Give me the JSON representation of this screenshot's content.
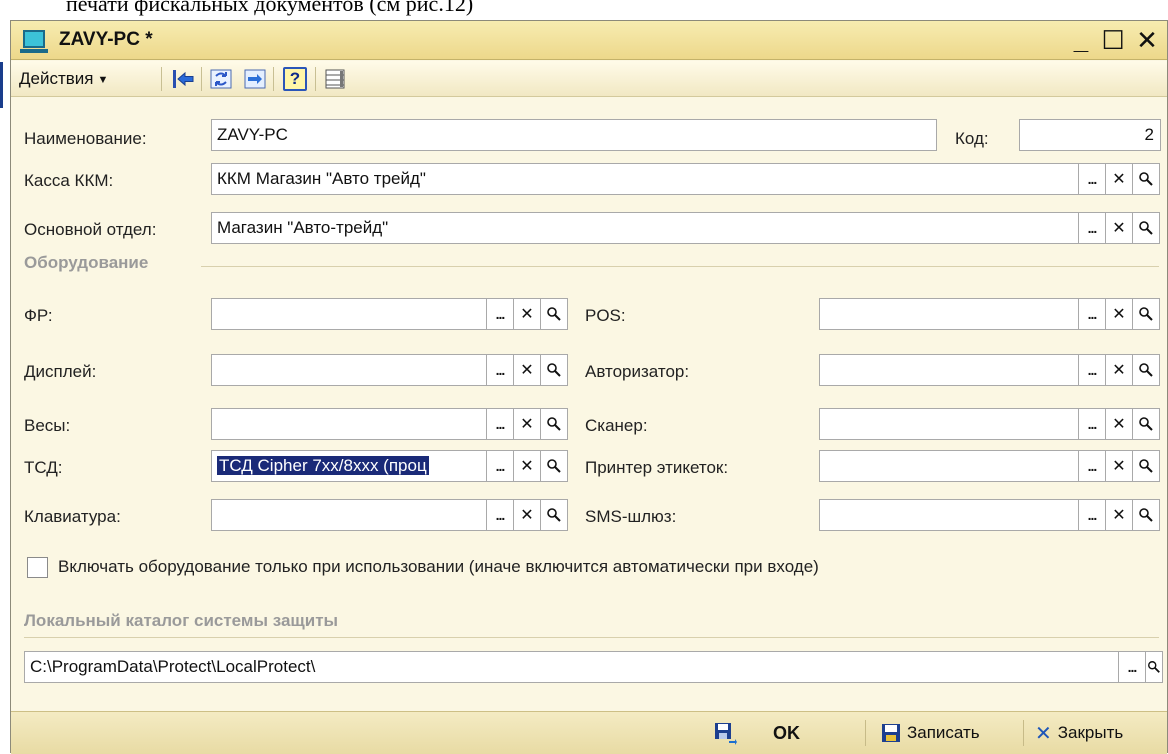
{
  "document_text": "печати фискальных документов (см рис.12)",
  "window": {
    "title": "ZAVY-PC *",
    "minimize": "_",
    "maximize": "☐",
    "close": "✕"
  },
  "toolbar": {
    "actions_label": "Действия",
    "icons": [
      "back-arrow-icon",
      "refresh-icon",
      "transfer-icon",
      "help-icon",
      "list-view-icon"
    ],
    "help_label": "?"
  },
  "fields": {
    "name_label": "Наименование:",
    "name_value": "ZAVY-PC",
    "code_label": "Код:",
    "code_value": "2",
    "kassa_label": "Касса ККМ:",
    "kassa_value": "ККМ Магазин \"Авто трейд\"",
    "dept_label": "Основной отдел:",
    "dept_value": "Магазин \"Авто-трейд\""
  },
  "equipment": {
    "title": "Оборудование",
    "left": [
      {
        "label": "ФР:",
        "value": ""
      },
      {
        "label": "Дисплей:",
        "value": ""
      },
      {
        "label": "Весы:",
        "value": ""
      },
      {
        "label": "ТСД:",
        "value": "ТСД Cipher 7xx/8xxx (проц"
      },
      {
        "label": "Клавиатура:",
        "value": ""
      }
    ],
    "right": [
      {
        "label": "POS:",
        "value": ""
      },
      {
        "label": "Авторизатор:",
        "value": ""
      },
      {
        "label": "Сканер:",
        "value": ""
      },
      {
        "label": "Принтер этикеток:",
        "value": ""
      },
      {
        "label": "SMS-шлюз:",
        "value": ""
      }
    ]
  },
  "checkbox": {
    "label": "Включать оборудование только при использовании (иначе включится автоматически при входе)",
    "checked": false
  },
  "protection": {
    "title": "Локальный каталог системы защиты",
    "path": "C:\\ProgramData\\Protect\\LocalProtect\\"
  },
  "field_buttons": {
    "select": "...",
    "clear": "✕"
  },
  "footer": {
    "ok_label": "OK",
    "write_label": "Записать",
    "close_label": "Закрыть"
  },
  "colors": {
    "title_bar": "#f0dd93",
    "form_bg": "#fbf7e3",
    "selection": "#1a2a78",
    "close_x": "#1e56b8"
  }
}
